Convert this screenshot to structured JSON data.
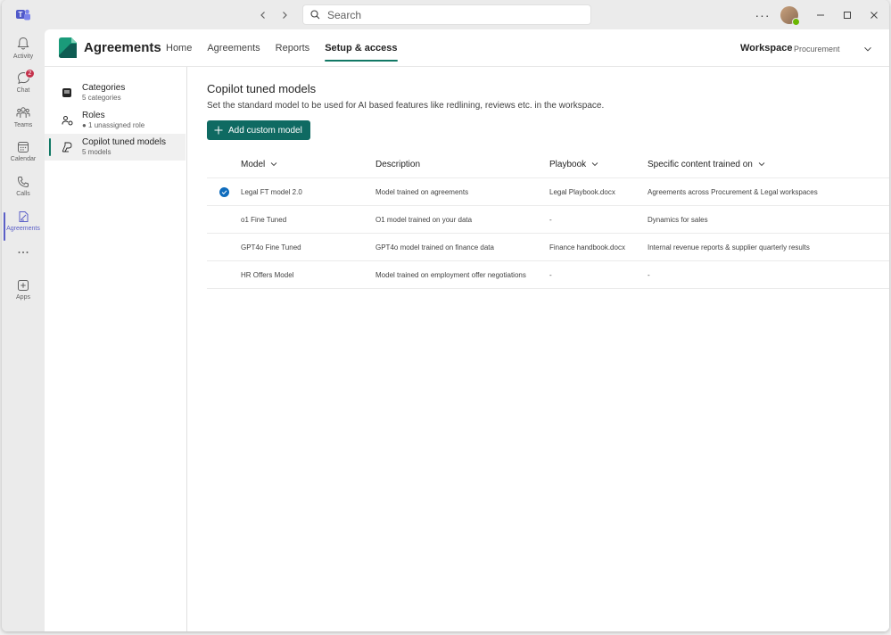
{
  "search": {
    "placeholder": "Search"
  },
  "rail": {
    "items": [
      {
        "label": "Activity",
        "icon": "bell-icon"
      },
      {
        "label": "Chat",
        "icon": "chat-icon",
        "badge": "2"
      },
      {
        "label": "Teams",
        "icon": "teams-icon"
      },
      {
        "label": "Calendar",
        "icon": "calendar-icon"
      },
      {
        "label": "Calls",
        "icon": "phone-icon"
      },
      {
        "label": "Agreements",
        "icon": "agreements-icon"
      },
      {
        "label": "",
        "icon": "more-icon"
      },
      {
        "label": "Apps",
        "icon": "apps-icon"
      }
    ]
  },
  "app": {
    "title": "Agreements",
    "nav": [
      "Home",
      "Agreements",
      "Reports",
      "Setup & access"
    ],
    "active_nav": "Setup & access",
    "workspace_label": "Workspace",
    "workspace_value": "Procurement"
  },
  "side": {
    "items": [
      {
        "title": "Categories",
        "sub": "5 categories"
      },
      {
        "title": "Roles",
        "sub": "● 1 unassigned role"
      },
      {
        "title": "Copilot tuned models",
        "sub": "5 models"
      }
    ]
  },
  "content": {
    "title": "Copilot tuned models",
    "description": "Set the standard model to be used for AI based features like redlining, reviews etc. in the workspace.",
    "add_button": "Add custom model",
    "columns": {
      "model": "Model",
      "description": "Description",
      "playbook": "Playbook",
      "specific": "Specific content trained on"
    },
    "rows": [
      {
        "model": "Legal FT model 2.0",
        "description": "Model trained on agreements",
        "playbook": "Legal Playbook.docx",
        "specific": "Agreements across Procurement & Legal workspaces",
        "selected": true
      },
      {
        "model": "o1 Fine Tuned",
        "description": "O1 model trained on your data",
        "playbook": "-",
        "specific": "Dynamics for sales",
        "selected": false
      },
      {
        "model": "GPT4o Fine Tuned",
        "description": "GPT4o model trained on finance data",
        "playbook": "Finance handbook.docx",
        "specific": "Internal revenue reports & supplier quarterly results",
        "selected": false
      },
      {
        "model": "HR Offers Model",
        "description": "Model trained on employment offer negotiations",
        "playbook": "-",
        "specific": "-",
        "selected": false
      }
    ]
  },
  "colors": {
    "accent": "#117865",
    "button": "#0f6a62",
    "teams": "#5b5fc7",
    "check": "#0f6cbd"
  }
}
